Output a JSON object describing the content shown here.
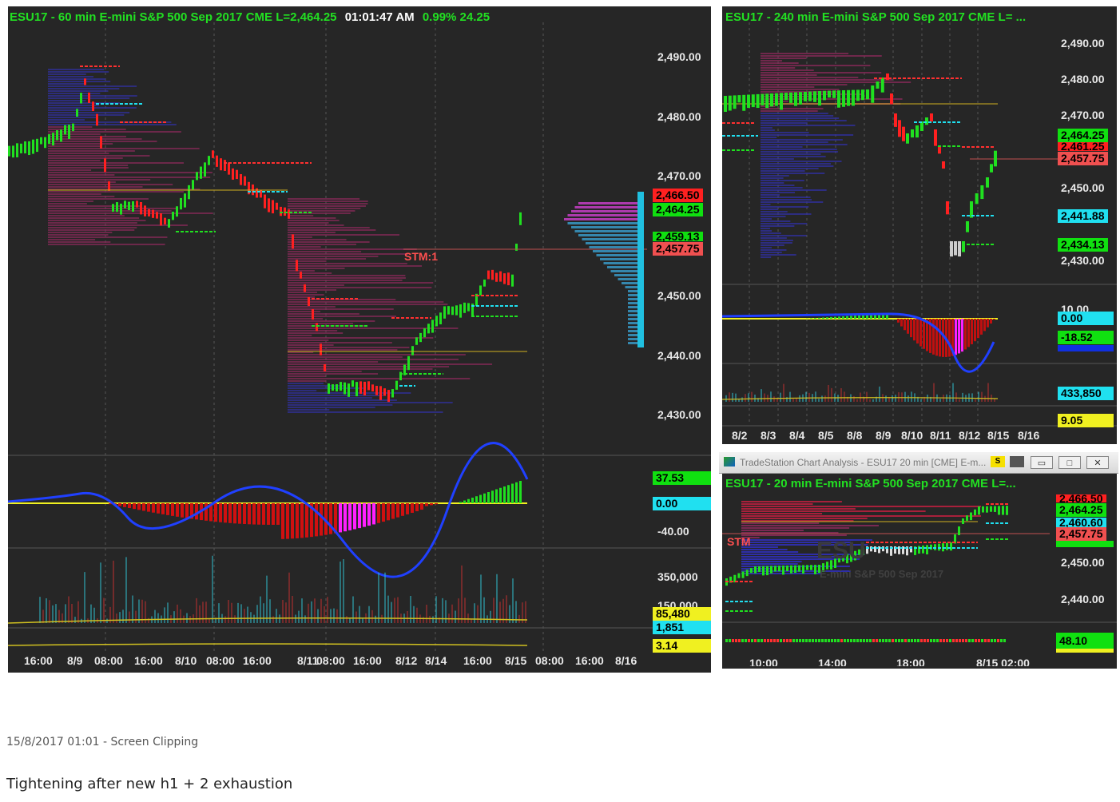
{
  "main_chart": {
    "title": {
      "symbol": "ESU17 - 60 min  E-mini S&P 500 Sep 2017  CME  L=2,464.25",
      "time": "01:01:47 AM",
      "change": "0.99%  24.25"
    },
    "price_axis": [
      "2,490.00",
      "2,480.00",
      "2,470.00",
      "2,440.00",
      "2,430.00",
      "2,450.00"
    ],
    "price_tags": [
      {
        "value": "2,466.50",
        "bg": "#ff2020"
      },
      {
        "value": "2,464.25",
        "bg": "#10e010"
      },
      {
        "value": "2,459.13",
        "bg": "#10e010"
      },
      {
        "value": "2,457.75",
        "bg": "#f05050"
      }
    ],
    "annotation": "STM:1",
    "oscillator_labels": {
      "top": "37.53",
      "zero": "0.00",
      "low": "-40.00"
    },
    "volume_labels": {
      "high": "350,000",
      "mid": "150,000",
      "vol": "85,480",
      "avg": "1,851",
      "ratio": "3.14"
    },
    "x_axis": [
      "16:00",
      "8/9",
      "08:00",
      "16:00",
      "8/10",
      "08:00",
      "16:00",
      "8/11",
      "08:00",
      "16:00",
      "8/12",
      "8/14",
      "16:00",
      "8/15",
      "08:00",
      "16:00",
      "8/16"
    ]
  },
  "chart_240": {
    "title": "ESU17 - 240 min  E-mini S&P 500 Sep 2017  CME  L= ...",
    "price_axis": [
      "2,490.00",
      "2,480.00",
      "2,470.00",
      "2,450.00",
      "2,430.00"
    ],
    "price_tags": [
      {
        "value": "2,464.25",
        "bg": "#10e010"
      },
      {
        "value": "2,461.25",
        "bg": "#ff2020"
      },
      {
        "value": "2,457.75",
        "bg": "#f05050"
      },
      {
        "value": "2,441.88",
        "bg": "#20e0f0"
      },
      {
        "value": "2,434.13",
        "bg": "#10e010"
      }
    ],
    "oscillator_labels": {
      "top": "10.00",
      "zero": "0.00",
      "value": "-18.52"
    },
    "volume_labels": {
      "vol": "433,850",
      "ratio": "9.05"
    },
    "x_axis": [
      "8/2",
      "8/3",
      "8/4",
      "8/5",
      "8/8",
      "8/9",
      "8/10",
      "8/11",
      "8/12",
      "8/15",
      "8/16"
    ]
  },
  "chart_20": {
    "window_title": "TradeStation Chart Analysis - ESU17 20 min [CME] E-m...",
    "buttons": {
      "minimize": "▭",
      "restore": "□",
      "close": "✕"
    },
    "title": "ESU17 - 20 min  E-mini S&P 500 Sep 2017  CME  L=...",
    "watermark": "E-mini S&P 500 Sep 2017",
    "price_axis": [
      "2,450.00",
      "2,440.00"
    ],
    "price_tags": [
      {
        "value": "2,466.50",
        "bg": "#ff2020"
      },
      {
        "value": "2,464.25",
        "bg": "#10e010"
      },
      {
        "value": "2,460.60",
        "bg": "#20e0f0"
      },
      {
        "value": "2,457.75",
        "bg": "#f05050"
      }
    ],
    "annotation": "STM",
    "oscillator_value": "48.10",
    "x_axis": [
      "10:00",
      "14:00",
      "18:00",
      "8/15 02:00"
    ]
  },
  "caption": {
    "timestamp": "15/8/2017 01:01 - Screen Clipping",
    "note": "Tightening after new h1 + 2 exhaustion"
  }
}
